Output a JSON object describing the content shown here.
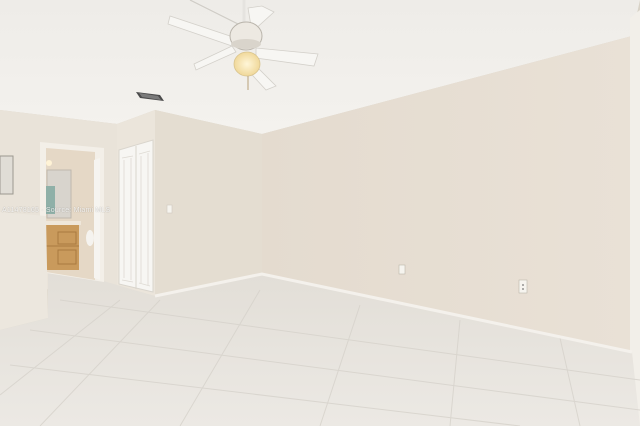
{
  "photo": {
    "subject": "empty-bedroom-interior",
    "watermark": "A11478165 · Source: Miami MLS"
  },
  "colors": {
    "ceiling": "#f1efea",
    "wall_right": "#e6ddd1",
    "wall_center": "#e3dcd0",
    "wall_left": "#e8e1d6",
    "floor": "#e4e1dc",
    "cabinet": "#c99a5c"
  }
}
